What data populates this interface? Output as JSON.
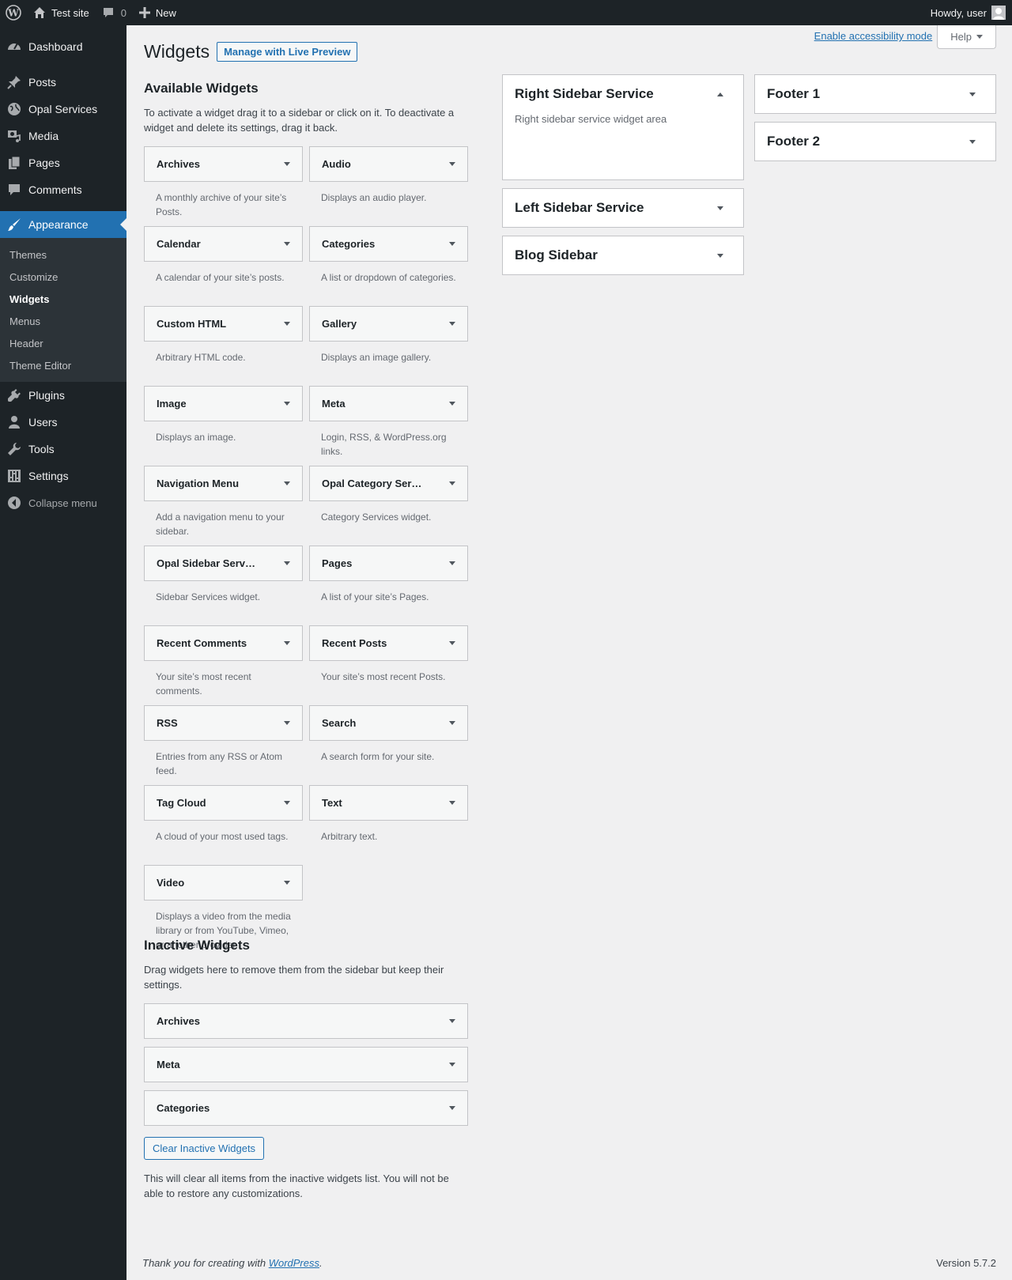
{
  "adminbar": {
    "site_name": "Test site",
    "comments_count": "0",
    "new_label": "New",
    "howdy": "Howdy, user"
  },
  "menu": {
    "dashboard": "Dashboard",
    "posts": "Posts",
    "opal_services": "Opal Services",
    "media": "Media",
    "pages": "Pages",
    "comments": "Comments",
    "appearance": "Appearance",
    "submenu": [
      "Themes",
      "Customize",
      "Widgets",
      "Menus",
      "Header",
      "Theme Editor"
    ],
    "plugins": "Plugins",
    "users": "Users",
    "tools": "Tools",
    "settings": "Settings",
    "collapse": "Collapse menu"
  },
  "screen": {
    "a11y_link": "Enable accessibility mode",
    "help": "Help"
  },
  "page": {
    "title": "Widgets",
    "live_preview": "Manage with Live Preview"
  },
  "available": {
    "heading": "Available Widgets",
    "description": "To activate a widget drag it to a sidebar or click on it. To deactivate a widget and delete its settings, drag it back.",
    "widgets": [
      {
        "name": "Archives",
        "desc": "A monthly archive of your site’s Posts."
      },
      {
        "name": "Audio",
        "desc": "Displays an audio player."
      },
      {
        "name": "Calendar",
        "desc": "A calendar of your site’s posts."
      },
      {
        "name": "Categories",
        "desc": "A list or dropdown of categories."
      },
      {
        "name": "Custom HTML",
        "desc": "Arbitrary HTML code."
      },
      {
        "name": "Gallery",
        "desc": "Displays an image gallery."
      },
      {
        "name": "Image",
        "desc": "Displays an image."
      },
      {
        "name": "Meta",
        "desc": "Login, RSS, & WordPress.org links."
      },
      {
        "name": "Navigation Menu",
        "desc": "Add a navigation menu to your sidebar."
      },
      {
        "name": "Opal Category Ser…",
        "desc": "Category Services widget."
      },
      {
        "name": "Opal Sidebar Serv…",
        "desc": "Sidebar Services widget."
      },
      {
        "name": "Pages",
        "desc": "A list of your site’s Pages."
      },
      {
        "name": "Recent Comments",
        "desc": "Your site’s most recent comments."
      },
      {
        "name": "Recent Posts",
        "desc": "Your site’s most recent Posts."
      },
      {
        "name": "RSS",
        "desc": "Entries from any RSS or Atom feed."
      },
      {
        "name": "Search",
        "desc": "A search form for your site."
      },
      {
        "name": "Tag Cloud",
        "desc": "A cloud of your most used tags."
      },
      {
        "name": "Text",
        "desc": "Arbitrary text."
      },
      {
        "name": "Video",
        "desc": "Displays a video from the media library or from YouTube, Vimeo, or another provider."
      }
    ]
  },
  "inactive": {
    "heading": "Inactive Widgets",
    "description": "Drag widgets here to remove them from the sidebar but keep their settings.",
    "items": [
      "Archives",
      "Meta",
      "Categories"
    ],
    "clear_button": "Clear Inactive Widgets",
    "clear_note": "This will clear all items from the inactive widgets list. You will not be able to restore any customizations."
  },
  "sidebars": {
    "right_service": {
      "title": "Right Sidebar Service",
      "desc": "Right sidebar service widget area"
    },
    "left_service": {
      "title": "Left Sidebar Service"
    },
    "blog": {
      "title": "Blog Sidebar"
    },
    "footer1": {
      "title": "Footer 1"
    },
    "footer2": {
      "title": "Footer 2"
    }
  },
  "footer": {
    "thanks_prefix": "Thank you for creating with ",
    "thanks_link": "WordPress",
    "thanks_suffix": ".",
    "version": "Version 5.7.2"
  }
}
